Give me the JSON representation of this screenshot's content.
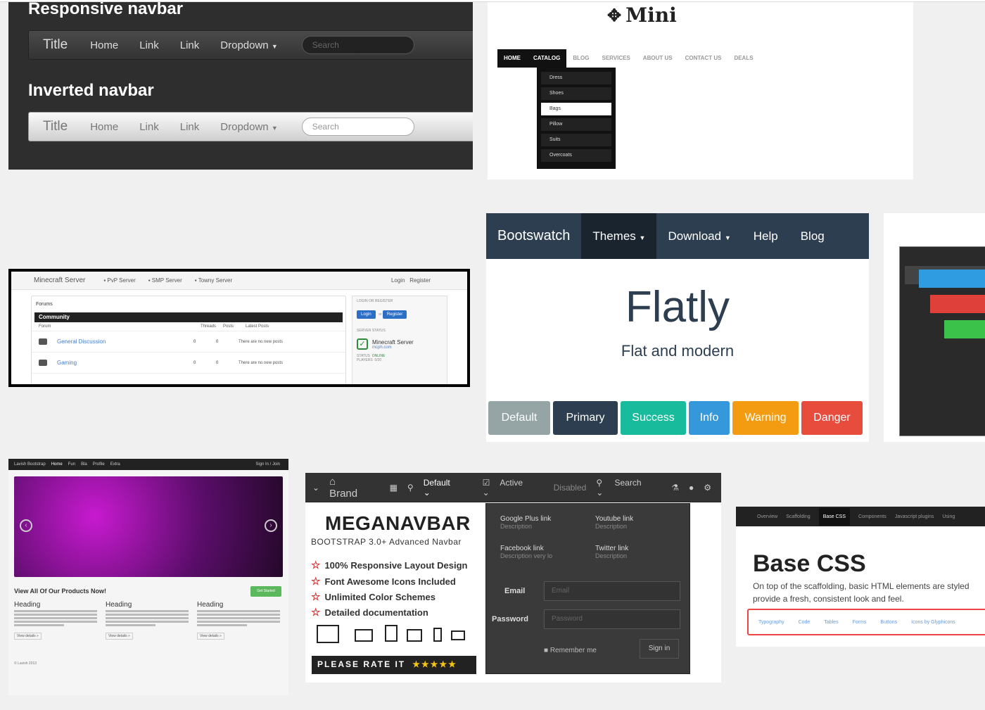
{
  "tiles": {
    "responsive": {
      "heading1": "Responsive navbar",
      "heading2": "Inverted navbar",
      "title": "Title",
      "items": [
        "Home",
        "Link",
        "Link",
        "Dropdown"
      ],
      "search_placeholder": "Search"
    },
    "mini": {
      "logo": "Mini",
      "nav": [
        "HOME",
        "CATALOG",
        "BLOG",
        "SERVICES",
        "ABOUT US",
        "CONTACT US",
        "DEALS"
      ],
      "dropdown": [
        "Dress",
        "Shoes",
        "Bags",
        "Pillow",
        "Suits",
        "Overcoats"
      ]
    },
    "minecraft": {
      "brand": "Minecraft Server",
      "nav": [
        "PvP Server",
        "SMP Server",
        "Towny Server"
      ],
      "login": "Login",
      "register": "Register",
      "forums": "Forums",
      "community": "Community",
      "headers": [
        "Forum",
        "Threads",
        "Posts",
        "Latest Posts"
      ],
      "rows": [
        {
          "name": "General Discussion",
          "threads": "0",
          "posts": "0",
          "latest": "There are no new posts"
        },
        {
          "name": "Gaming",
          "threads": "0",
          "posts": "0",
          "latest": "There are no new posts"
        }
      ],
      "side_login_title": "LOGIN OR REGISTER",
      "side_login_btn": "Login",
      "side_or": "or",
      "side_register_btn": "Register",
      "server_status_title": "SERVER STATUS",
      "server_name": "Minecraft Server",
      "server_host": "mcph.com",
      "status_label": "STATUS",
      "status_value": "ONLINE",
      "players_label": "PLAYERS",
      "players_value": "0/20"
    },
    "flatly": {
      "brand": "Bootswatch",
      "nav": [
        "Themes",
        "Download",
        "Help",
        "Blog"
      ],
      "title": "Flatly",
      "subtitle": "Flat and modern",
      "buttons": [
        {
          "label": "Default",
          "color": "#95a5a6"
        },
        {
          "label": "Primary",
          "color": "#2c3e50"
        },
        {
          "label": "Success",
          "color": "#18bc9c"
        },
        {
          "label": "Info",
          "color": "#3498db"
        },
        {
          "label": "Warning",
          "color": "#f39c12"
        },
        {
          "label": "Danger",
          "color": "#e74c3c"
        }
      ]
    },
    "lavish": {
      "brand": "Lavish Bootstrap",
      "nav": [
        "Home",
        "Fun",
        "Bla",
        "Profile",
        "Extra"
      ],
      "nav_right": "Sign In / Join",
      "view_all": "View All Of Our Products Now!",
      "get_started": "Get Started",
      "columns": [
        {
          "heading": "Heading",
          "button": "View details »"
        },
        {
          "heading": "Heading",
          "button": "View details »"
        },
        {
          "heading": "Heading",
          "button": "View details »"
        }
      ],
      "copyright": "© Lavish 2013"
    },
    "meganavbar": {
      "brand": "Brand",
      "nav": [
        "Default",
        "Active",
        "Disabled"
      ],
      "search": "Search",
      "title": "MEGANAVBAR",
      "subtitle": "BOOTSTRAP 3.0+ Advanced Navbar",
      "features": [
        "100% Responsive Layout Design",
        "Font Awesome Icons Included",
        "Unlimited Color Schemes",
        "Detailed documentation"
      ],
      "rate": "PLEASE RATE IT",
      "stars": "★★★★★",
      "links": [
        {
          "label": "Google Plus link",
          "desc": "Description"
        },
        {
          "label": "Youtube link",
          "desc": "Description"
        },
        {
          "label": "Facebook link",
          "desc": "Description very lo"
        },
        {
          "label": "Twitter link",
          "desc": "Description"
        }
      ],
      "email_label": "Email",
      "email_placeholder": "Email",
      "password_label": "Password",
      "password_placeholder": "Password",
      "remember": "Remember me",
      "signin": "Sign in"
    },
    "basecss": {
      "nav": [
        "Overview",
        "Scaffolding",
        "Base CSS",
        "Components",
        "Javascript plugins",
        "Using"
      ],
      "title": "Base CSS",
      "desc1": "On top of the scaffolding, basic HTML elements are styled",
      "desc2": "provide a fresh, consistent look and feel.",
      "subnav": [
        "Typography",
        "Code",
        "Tables",
        "Forms",
        "Buttons",
        "Icons by Glyphicons"
      ]
    }
  }
}
